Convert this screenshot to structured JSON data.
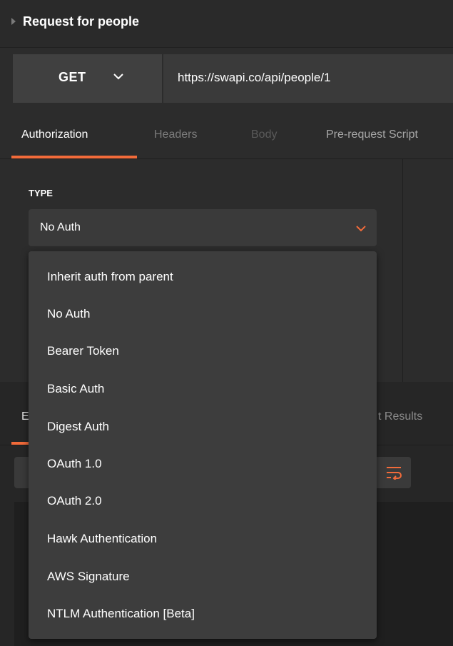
{
  "request": {
    "title": "Request for people",
    "method": "GET",
    "url": "https://swapi.co/api/people/1"
  },
  "tabs": [
    {
      "label": "Authorization"
    },
    {
      "label": "Headers"
    },
    {
      "label": "Body"
    },
    {
      "label": "Pre-request Script"
    }
  ],
  "auth": {
    "type_label": "TYPE",
    "selected": "No Auth",
    "options": [
      "Inherit auth from parent",
      "No Auth",
      "Bearer Token",
      "Basic Auth",
      "Digest Auth",
      "OAuth 1.0",
      "OAuth 2.0",
      "Hawk Authentication",
      "AWS Signature",
      "NTLM Authentication [Beta]"
    ]
  },
  "response": {
    "tab_partial": "E",
    "results_partial": "t Results"
  },
  "colors": {
    "accent": "#f26b3a",
    "code_green": "#9ec94a"
  }
}
